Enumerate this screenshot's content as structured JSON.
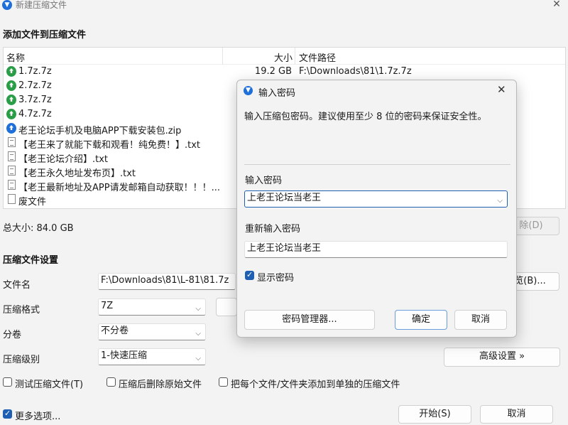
{
  "window": {
    "title": "新建压缩文件",
    "close_glyph": "✕"
  },
  "add_section": {
    "title": "添加文件到压缩文件"
  },
  "file_list": {
    "columns": {
      "name": "名称",
      "size": "大小",
      "path": "文件路径"
    },
    "rows": [
      {
        "icon": "archive-icon",
        "name": "1.7z.7z",
        "size": "19.2 GB",
        "path": "F:\\Downloads\\81\\1.7z.7z"
      },
      {
        "icon": "archive-icon",
        "name": "2.7z.7z",
        "size": "",
        "path": ""
      },
      {
        "icon": "archive-icon",
        "name": "3.7z.7z",
        "size": "",
        "path": ""
      },
      {
        "icon": "archive-icon",
        "name": "4.7z.7z",
        "size": "",
        "path": ""
      },
      {
        "icon": "zip-icon",
        "name": "老王论坛手机及电脑APP下载安装包.zip",
        "size": "",
        "path": ""
      },
      {
        "icon": "text-file-icon",
        "name": "【老王来了就能下载和观看！纯免费！】.txt",
        "size": "",
        "path": ""
      },
      {
        "icon": "text-file-icon",
        "name": "【老王论坛介绍】.txt",
        "size": "",
        "path": ""
      },
      {
        "icon": "text-file-icon",
        "name": "【老王永久地址发布页】.txt",
        "size": "",
        "path": ""
      },
      {
        "icon": "text-file-icon",
        "name": "【老王最新地址及APP请发邮箱自动获取！！！...",
        "size": "",
        "path": ""
      },
      {
        "icon": "folder-icon",
        "name": "废文件",
        "size": "",
        "path": ""
      }
    ]
  },
  "total_size": {
    "label": "总大小: 84.0 GB"
  },
  "remove_button": {
    "label": "除(D)"
  },
  "settings": {
    "title": "压缩文件设置",
    "filename_label": "文件名",
    "filename_value": "F:\\Downloads\\81\\L-81\\81.7z",
    "browse_label": "览(B)...",
    "format_label": "压缩格式",
    "format_value": "7Z",
    "split_label": "分卷",
    "split_value": "不分卷",
    "level_label": "压缩级别",
    "level_value": "1-快速压缩",
    "advanced_label": "高级设置 »",
    "test_label": "测试压缩文件(T)",
    "delete_label": "压缩后删除原始文件",
    "separate_label": "把每个文件/文件夹添加到单独的压缩文件",
    "more_label": "更多选项...",
    "start_label": "开始(S)",
    "cancel_label": "取消"
  },
  "password_dialog": {
    "title": "输入密码",
    "close_glyph": "✕",
    "description": "输入压缩包密码。建议使用至少 8 位的密码来保证安全性。",
    "password_label": "输入密码",
    "password_value": "上老王论坛当老王",
    "confirm_label": "重新输入密码",
    "confirm_value": "上老王论坛当老王",
    "show_password_label": "显示密码",
    "manager_label": "密码管理器...",
    "ok_label": "确定",
    "cancel_label": "取消"
  },
  "colors": {
    "accent": "#1e5fb4",
    "archive_green": "#2a9d47"
  }
}
